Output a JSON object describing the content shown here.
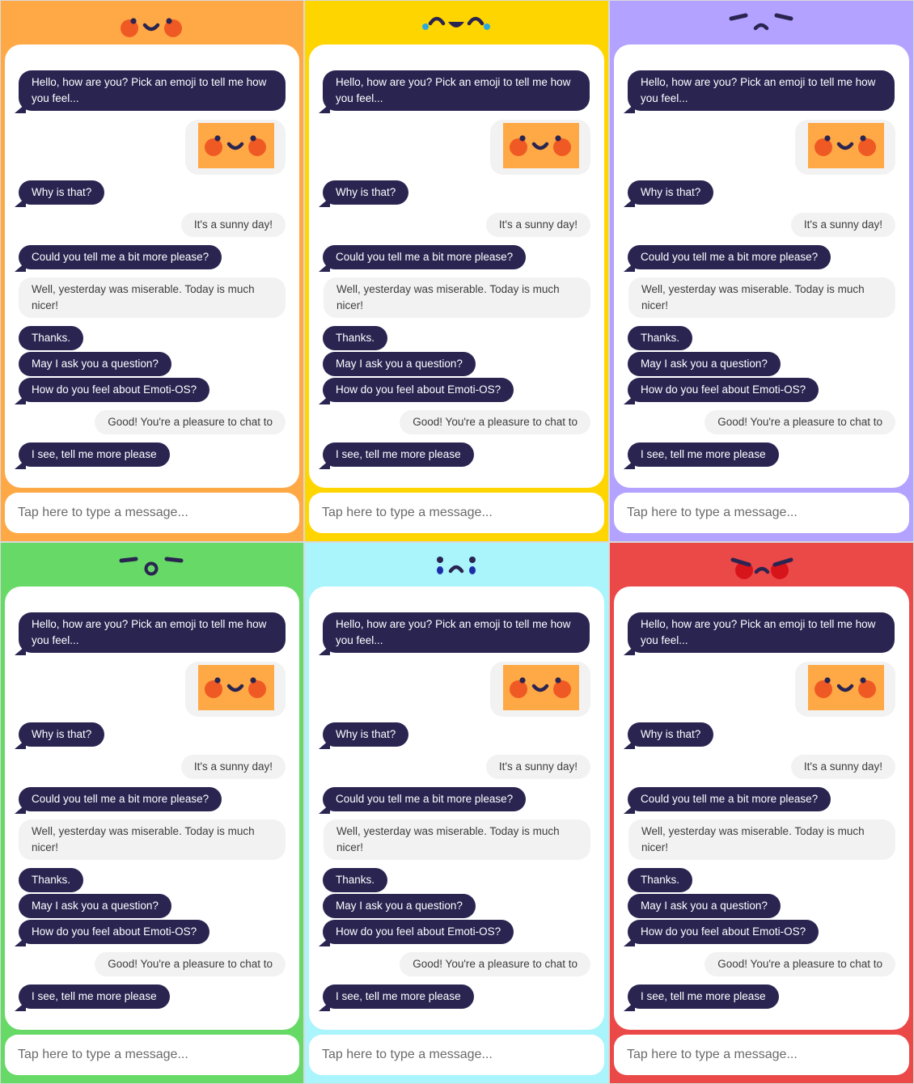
{
  "panels": [
    {
      "mood": "happy",
      "bg": "#ffa846",
      "bot_bubble_color": "#2a2451",
      "messages": {
        "greeting": "Hello, how are you? Pick an emoji to tell me how you feel...",
        "why": "Why is that?",
        "sunny": "It's a sunny day!",
        "more": "Could you tell me a bit more please?",
        "yesterday": "Well, yesterday was miserable. Today is much nicer!",
        "thanks": "Thanks.",
        "question": "May I ask you a question?",
        "feel_emoti": "How do you feel about Emoti-OS?",
        "good": "Good! You're a pleasure to chat to",
        "see": "I see, tell me more please"
      },
      "input_placeholder": "Tap here to type a message..."
    },
    {
      "mood": "laughing",
      "bg": "#ffd500",
      "bot_bubble_color": "#2a2451",
      "messages": {
        "greeting": "Hello, how are you? Pick an emoji to tell me how you feel...",
        "why": "Why is that?",
        "sunny": "It's a sunny day!",
        "more": "Could you tell me a bit more please?",
        "yesterday": "Well, yesterday was miserable. Today is much nicer!",
        "thanks": "Thanks.",
        "question": "May I ask you a question?",
        "feel_emoti": "How do you feel about Emoti-OS?",
        "good": "Good! You're a pleasure to chat to",
        "see": "I see, tell me more please"
      },
      "input_placeholder": "Tap here to type a message..."
    },
    {
      "mood": "annoyed",
      "bg": "#b3a2ff",
      "bot_bubble_color": "#2a2451",
      "messages": {
        "greeting": "Hello, how are you? Pick an emoji to tell me how you feel...",
        "why": "Why is that?",
        "sunny": "It's a sunny day!",
        "more": "Could you tell me a bit more please?",
        "yesterday": "Well, yesterday was miserable. Today is much nicer!",
        "thanks": "Thanks.",
        "question": "May I ask you a question?",
        "feel_emoti": "How do you feel about Emoti-OS?",
        "good": "Good! You're a pleasure to chat to",
        "see": "I see, tell me more please"
      },
      "input_placeholder": "Tap here to type a message..."
    },
    {
      "mood": "surprised",
      "bg": "#66d966",
      "bot_bubble_color": "#2a2451",
      "messages": {
        "greeting": "Hello, how are you? Pick an emoji to tell me how you feel...",
        "why": "Why is that?",
        "sunny": "It's a sunny day!",
        "more": "Could you tell me a bit more please?",
        "yesterday": "Well, yesterday was miserable. Today is much nicer!",
        "thanks": "Thanks.",
        "question": "May I ask you a question?",
        "feel_emoti": "How do you feel about Emoti-OS?",
        "good": "Good! You're a pleasure to chat to",
        "see": "I see, tell me more please"
      },
      "input_placeholder": "Tap here to type a message..."
    },
    {
      "mood": "sad",
      "bg": "#aaf4fb",
      "bot_bubble_color": "#2a2451",
      "messages": {
        "greeting": "Hello, how are you? Pick an emoji to tell me how you feel...",
        "why": "Why is that?",
        "sunny": "It's a sunny day!",
        "more": "Could you tell me a bit more please?",
        "yesterday": "Well, yesterday was miserable. Today is much nicer!",
        "thanks": "Thanks.",
        "question": "May I ask you a question?",
        "feel_emoti": "How do you feel about Emoti-OS?",
        "good": "Good! You're a pleasure to chat to",
        "see": "I see, tell me more please"
      },
      "input_placeholder": "Tap here to type a message..."
    },
    {
      "mood": "angry",
      "bg": "#eb4848",
      "bot_bubble_color": "#2a2451",
      "messages": {
        "greeting": "Hello, how are you? Pick an emoji to tell me how you feel...",
        "why": "Why is that?",
        "sunny": "It's a sunny day!",
        "more": "Could you tell me a bit more please?",
        "yesterday": "Well, yesterday was miserable. Today is much nicer!",
        "thanks": "Thanks.",
        "question": "May I ask you a question?",
        "feel_emoti": "How do you feel about Emoti-OS?",
        "good": "Good! You're a pleasure to chat to",
        "see": "I see, tell me more please"
      },
      "input_placeholder": "Tap here to type a message..."
    }
  ],
  "colors": {
    "face_dark": "#2a2451",
    "cheek": "#ef5a24",
    "tear": "#29abe2",
    "angry_cheek": "#d8141b",
    "sent_emoji_tile": "#ffa846",
    "user_bubble": "#f2f2f2"
  }
}
